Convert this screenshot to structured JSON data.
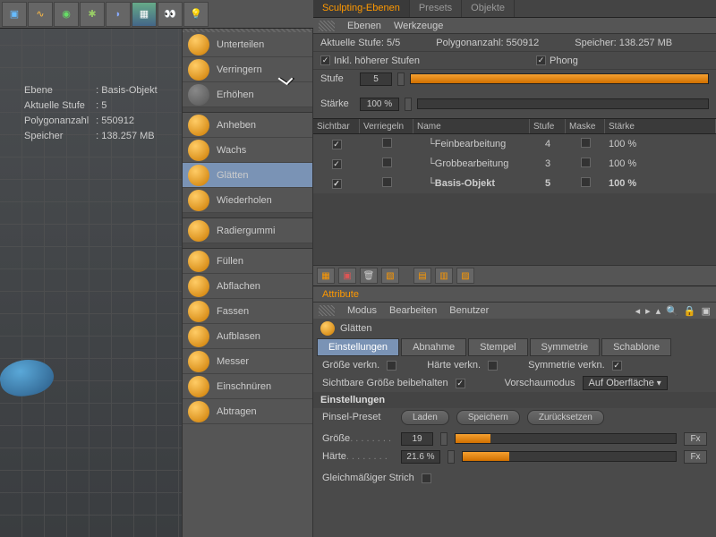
{
  "viewport_info": {
    "ebene_label": "Ebene",
    "ebene_value": "Basis-Objekt",
    "stufe_label": "Aktuelle Stufe",
    "stufe_value": "5",
    "poly_label": "Polygonanzahl",
    "poly_value": "550912",
    "mem_label": "Speicher",
    "mem_value": "138.257 MB"
  },
  "tools": [
    {
      "label": "Unterteilen",
      "sel": false,
      "dim": false
    },
    {
      "label": "Verringern",
      "sel": false,
      "dim": false
    },
    {
      "label": "Erhöhen",
      "sel": false,
      "dim": true
    },
    {
      "label": "Anheben",
      "sel": false,
      "dim": false
    },
    {
      "label": "Wachs",
      "sel": false,
      "dim": false
    },
    {
      "label": "Glätten",
      "sel": true,
      "dim": false
    },
    {
      "label": "Wiederholen",
      "sel": false,
      "dim": false
    },
    {
      "label": "Radiergummi",
      "sel": false,
      "dim": false
    },
    {
      "label": "Füllen",
      "sel": false,
      "dim": false
    },
    {
      "label": "Abflachen",
      "sel": false,
      "dim": false
    },
    {
      "label": "Fassen",
      "sel": false,
      "dim": false
    },
    {
      "label": "Aufblasen",
      "sel": false,
      "dim": false
    },
    {
      "label": "Messer",
      "sel": false,
      "dim": false
    },
    {
      "label": "Einschnüren",
      "sel": false,
      "dim": false
    },
    {
      "label": "Abtragen",
      "sel": false,
      "dim": false
    }
  ],
  "right_tabs": [
    "Sculpting-Ebenen",
    "Presets",
    "Objekte"
  ],
  "sub_tabs": [
    "Ebenen",
    "Werkzeuge"
  ],
  "status": {
    "stufe": "Aktuelle Stufe:  5/5",
    "poly": "Polygonanzahl:  550912",
    "mem": "Speicher:   138.257 MB",
    "inkl": "Inkl. höherer Stufen",
    "phong": "Phong"
  },
  "sliders": {
    "stufe_label": "Stufe",
    "stufe_val": "5",
    "staerke_label": "Stärke",
    "staerke_val": "100 %"
  },
  "columns": [
    "Sichtbar",
    "Verriegeln",
    "Name",
    "Stufe",
    "Maske",
    "Stärke"
  ],
  "layers": [
    {
      "name": "Feinbearbeitung",
      "stufe": "4",
      "staerke": "100 %",
      "sel": false
    },
    {
      "name": "Grobbearbeitung",
      "stufe": "3",
      "staerke": "100 %",
      "sel": false
    },
    {
      "name": "Basis-Objekt",
      "stufe": "5",
      "staerke": "100 %",
      "sel": true
    }
  ],
  "attr_tab": "Attribute",
  "attr_menu": [
    "Modus",
    "Bearbeiten",
    "Benutzer"
  ],
  "brush_name": "Glätten",
  "brush_tabs": [
    "Einstellungen",
    "Abnahme",
    "Stempel",
    "Symmetrie",
    "Schablone"
  ],
  "form": {
    "groesse_verkn": "Größe verkn.",
    "haerte_verkn": "Härte verkn.",
    "sym_verkn": "Symmetrie verkn.",
    "sichtbare": "Sichtbare Größe beibehalten",
    "vorschau": "Vorschaumodus",
    "vorschau_val": "Auf Oberfläche",
    "sect": "Einstellungen",
    "preset": "Pinsel-Preset",
    "laden": "Laden",
    "speichern": "Speichern",
    "zurueck": "Zurücksetzen",
    "groesse": "Größe",
    "groesse_val": "19",
    "haerte": "Härte",
    "haerte_val": "21.6 %",
    "gleich": "Gleichmäßiger Strich",
    "fx": "Fx"
  }
}
